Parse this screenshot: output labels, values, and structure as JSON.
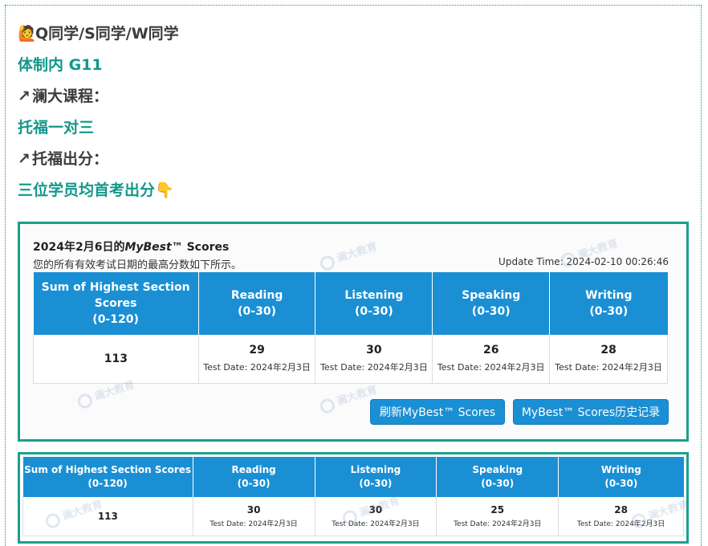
{
  "post": {
    "students_line": "Q同学/S同学/W同学",
    "school_line": "体制内 G11",
    "course_heading": "澜大课程：",
    "course_value": "托福一对三",
    "result_heading": "托福出分：",
    "result_value": "三位学员均首考出分",
    "icons": {
      "person": "person-raising-hand-icon",
      "arrow": "arrow-up-right-icon",
      "point": "point-down-icon"
    }
  },
  "screenshot1": {
    "title_prefix": "2024年2月6日的",
    "title_brand": "MyBest",
    "title_suffix": "™ Scores",
    "subtitle": "您的所有有效考试日期的最高分数如下所示。",
    "update_time": "Update Time: 2024-02-10 00:26:46",
    "headers": [
      {
        "name": "Sum of Highest Section Scores",
        "range": "(0-120)"
      },
      {
        "name": "Reading",
        "range": "(0-30)"
      },
      {
        "name": "Listening",
        "range": "(0-30)"
      },
      {
        "name": "Speaking",
        "range": "(0-30)"
      },
      {
        "name": "Writing",
        "range": "(0-30)"
      }
    ],
    "total": "113",
    "sections": [
      {
        "score": "29",
        "date": "Test Date: 2024年2月3日"
      },
      {
        "score": "30",
        "date": "Test Date: 2024年2月3日"
      },
      {
        "score": "26",
        "date": "Test Date: 2024年2月3日"
      },
      {
        "score": "28",
        "date": "Test Date: 2024年2月3日"
      }
    ],
    "refresh_button": "刷新MyBest™ Scores",
    "history_button": "MyBest™ Scores历史记录"
  },
  "screenshot2": {
    "headers": [
      {
        "name": "Sum of Highest Section Scores",
        "range": "(0-120)"
      },
      {
        "name": "Reading",
        "range": "(0-30)"
      },
      {
        "name": "Listening",
        "range": "(0-30)"
      },
      {
        "name": "Speaking",
        "range": "(0-30)"
      },
      {
        "name": "Writing",
        "range": "(0-30)"
      }
    ],
    "total": "113",
    "sections": [
      {
        "score": "30",
        "date": "Test Date: 2024年2月3日"
      },
      {
        "score": "30",
        "date": "Test Date: 2024年2月3日"
      },
      {
        "score": "25",
        "date": "Test Date: 2024年2月3日"
      },
      {
        "score": "28",
        "date": "Test Date: 2024年2月3日"
      }
    ]
  },
  "watermark": {
    "cn": "澜大教育",
    "en": "LANDWAVE"
  },
  "colors": {
    "teal": "#13978b",
    "header_blue": "#1b8fd4",
    "border_teal": "#1aa08d"
  }
}
